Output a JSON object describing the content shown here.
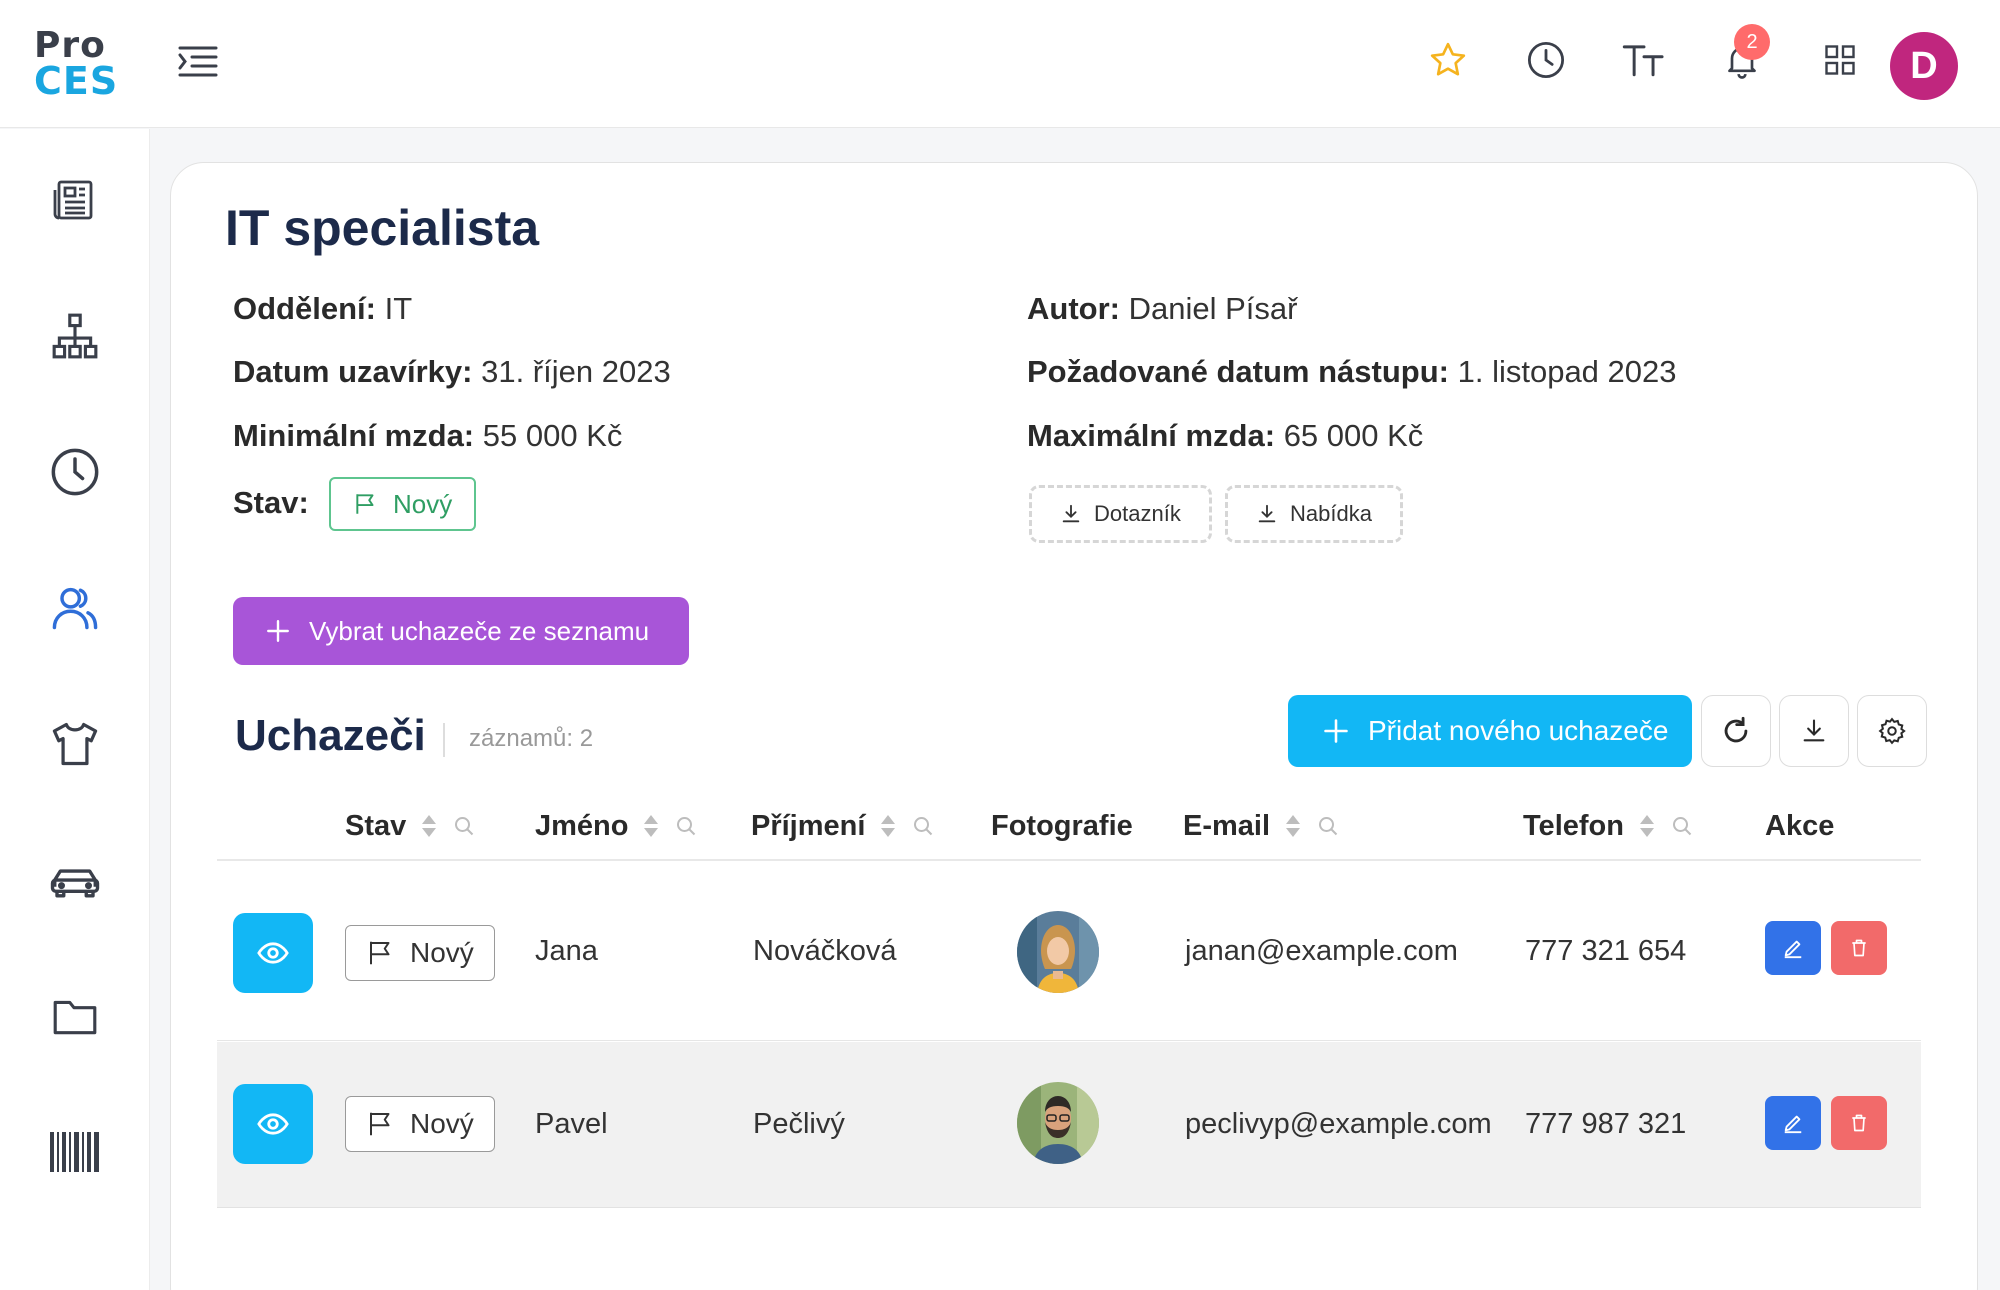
{
  "header": {
    "logo_line1": "Pro",
    "logo_line2": "CES",
    "notifications_count": "2",
    "user_initial": "D",
    "icons": [
      "menu-icon",
      "star-icon",
      "history-icon",
      "text-size-icon",
      "bell-icon",
      "apps-grid-icon"
    ]
  },
  "sidebar": {
    "items": [
      "newspaper-icon",
      "org-chart-icon",
      "clock-icon",
      "users-icon",
      "tshirt-icon",
      "car-icon",
      "folder-icon",
      "barcode-icon"
    ],
    "active": "users-icon"
  },
  "position": {
    "title": "IT specialista",
    "department_label": "Oddělení:",
    "department_value": "IT",
    "author_label": "Autor:",
    "author_value": "Daniel Písař",
    "deadline_label": "Datum uzavírky:",
    "deadline_value": "31. říjen 2023",
    "start_label": "Požadované datum nástupu:",
    "start_value": "1. listopad 2023",
    "min_salary_label": "Minimální mzda:",
    "min_salary_value": "55 000 Kč",
    "max_salary_label": "Maximální mzda:",
    "max_salary_value": "65 000 Kč",
    "status_label": "Stav:",
    "status_value": "Nový",
    "download_questionnaire": "Dotazník",
    "download_offer": "Nabídka",
    "select_candidates": "Vybrat uchazeče ze seznamu"
  },
  "candidates": {
    "title": "Uchazeči",
    "records": "záznamů: 2",
    "add_button": "Přidat nového uchazeče",
    "columns": {
      "status": "Stav",
      "first_name": "Jméno",
      "last_name": "Příjmení",
      "photo": "Fotografie",
      "email": "E-mail",
      "phone": "Telefon",
      "actions": "Akce"
    },
    "rows": [
      {
        "status": "Nový",
        "first_name": "Jana",
        "last_name": "Nováčková",
        "email": "janan@example.com",
        "phone": "777 321 654"
      },
      {
        "status": "Nový",
        "first_name": "Pavel",
        "last_name": "Pečlivý",
        "email": "peclivyp@example.com",
        "phone": "777 987 321"
      }
    ]
  },
  "colors": {
    "accent_blue": "#12b7f5",
    "purple": "#a855d8",
    "status_green": "#2f9e63",
    "edit_blue": "#3272e8",
    "delete_red": "#f26a6a",
    "avatar": "#c0267e"
  }
}
